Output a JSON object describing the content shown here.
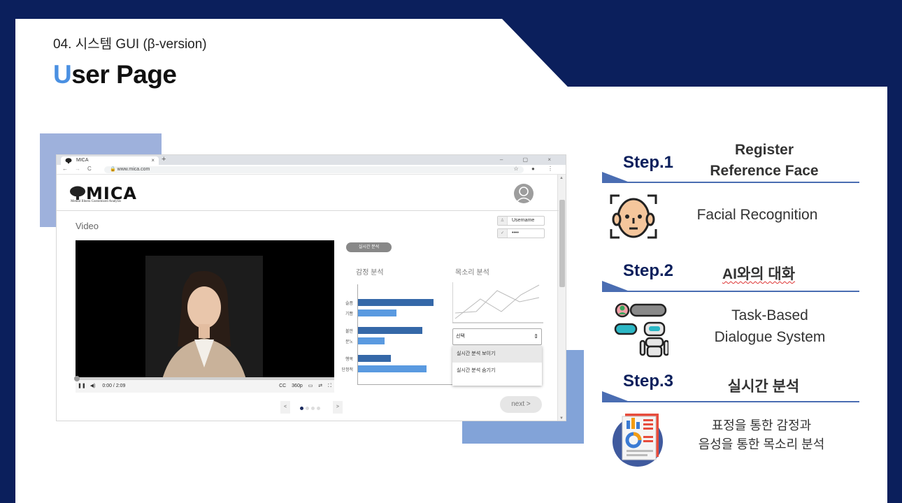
{
  "slide": {
    "section_label": "04. 시스템 GUI (β-version)",
    "title_accent": "U",
    "title_rest": "ser Page"
  },
  "browser": {
    "tab_title": "MICA",
    "tab_close": "×",
    "new_tab": "+",
    "window_controls": "– ▢ ×",
    "url": "www.mica.com",
    "nav": {
      "back": "←",
      "forward": "→",
      "reload": "C"
    },
    "addr_icons": "☆ ● ⋮"
  },
  "app": {
    "logo_text": "MICA",
    "logo_subtitle": "Mental Illness Customized Analysis",
    "video_label": "Video",
    "username_placeholder": "Username",
    "password_value": "••••",
    "video_time": "0:00 / 2:09",
    "video_quality": "360p",
    "realtime_badge": "실시간 분석",
    "emotion_title": "감정 분석",
    "voice_title": "목소리 분석",
    "select_value": "선택",
    "dropdown_options": [
      "실시간 분석 보이기",
      "실시간 분석 숨기기"
    ],
    "next_label": "next >",
    "pager_prev": "<",
    "pager_next": ">",
    "page_count": 4,
    "current_page": 1
  },
  "chart_data": {
    "type": "bar",
    "title": "감정 분석",
    "orientation": "horizontal",
    "categories": [
      "슬픔",
      "기쁨",
      "불안",
      "분노",
      "행복",
      "단정적"
    ],
    "values": [
      0.9,
      0.46,
      0.77,
      0.32,
      0.39,
      0.82
    ],
    "colors": [
      "#3568a8",
      "#5a9ae0",
      "#3568a8",
      "#5a9ae0",
      "#3568a8",
      "#5a9ae0"
    ],
    "xlabel": "",
    "ylabel": ""
  },
  "steps": [
    {
      "num": "Step.1",
      "title": "Register Reference Face",
      "desc": "Facial Recognition",
      "icon": "face-scan-icon"
    },
    {
      "num": "Step.2",
      "title": "AI와의 대화",
      "desc_lines": [
        "Task-Based",
        "Dialogue System"
      ],
      "icon": "robot-chat-icon"
    },
    {
      "num": "Step.3",
      "title": "실시간 분석",
      "desc_lines": [
        "표정을 통한 감정과",
        "음성을 통한 목소리 분석"
      ],
      "icon": "report-icon"
    }
  ],
  "colors": {
    "background": "#0b1f5c",
    "accent": "#4a90e2",
    "step_line": "#4a6db2"
  }
}
